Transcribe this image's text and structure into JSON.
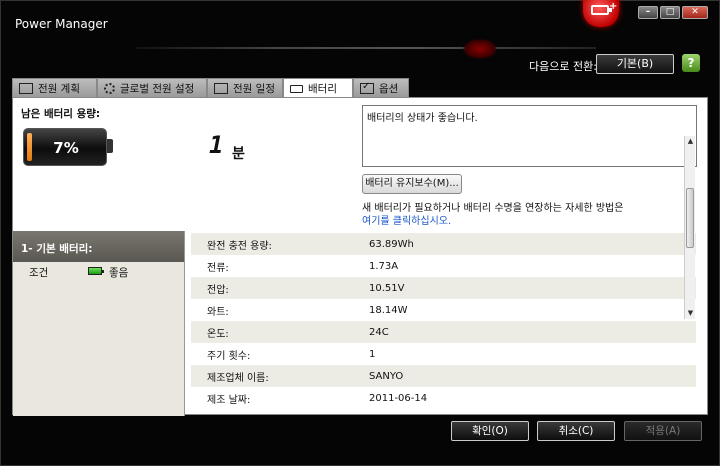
{
  "window": {
    "title": "Power Manager"
  },
  "header": {
    "switch_label": "다음으로 전환:",
    "switch_button": "기본(B)",
    "help_icon": "?"
  },
  "tabs": [
    {
      "label": "전원 계획",
      "icon": "plan-icon"
    },
    {
      "label": "글로벌 전원 설정",
      "icon": "gear-icon"
    },
    {
      "label": "전원 일정",
      "icon": "schedule-icon"
    },
    {
      "label": "배터리",
      "icon": "battery-icon",
      "active": true
    },
    {
      "label": "옵션",
      "icon": "checkbox-icon"
    }
  ],
  "battery": {
    "remaining_label": "남은 배터리 용량:",
    "percent": "7%",
    "level": 0.07,
    "time_value": "1",
    "time_unit": "분",
    "status_text": "배터리의 상태가 좋습니다.",
    "maintenance_button": "배터리 유지보수(M)...",
    "info_text": "새 배터리가 필요하거나 배터리 수명을 연장하는 자세한 방법은",
    "info_link": "여기를 클릭하십시오."
  },
  "left_pane": {
    "heading": "1- 기본 배터리:",
    "condition_label": "조건",
    "condition_value": "좋음"
  },
  "details": [
    {
      "key": "완전 충전 용량:",
      "value": "63.89Wh"
    },
    {
      "key": "전류:",
      "value": "1.73A"
    },
    {
      "key": "전압:",
      "value": "10.51V"
    },
    {
      "key": "와트:",
      "value": "18.14W"
    },
    {
      "key": "온도:",
      "value": "24C"
    },
    {
      "key": "주기 횟수:",
      "value": "1"
    },
    {
      "key": "제조업체 이름:",
      "value": "SANYO"
    },
    {
      "key": "제조 날짜:",
      "value": "2011-06-14"
    }
  ],
  "buttons": {
    "ok": "확인(O)",
    "cancel": "취소(C)",
    "apply": "적용(A)"
  },
  "colors": {
    "link": "#1a57c9",
    "battery_fill": "#e47a0c",
    "good_battery": "#1c9a10",
    "brand_red": "#c00000"
  }
}
